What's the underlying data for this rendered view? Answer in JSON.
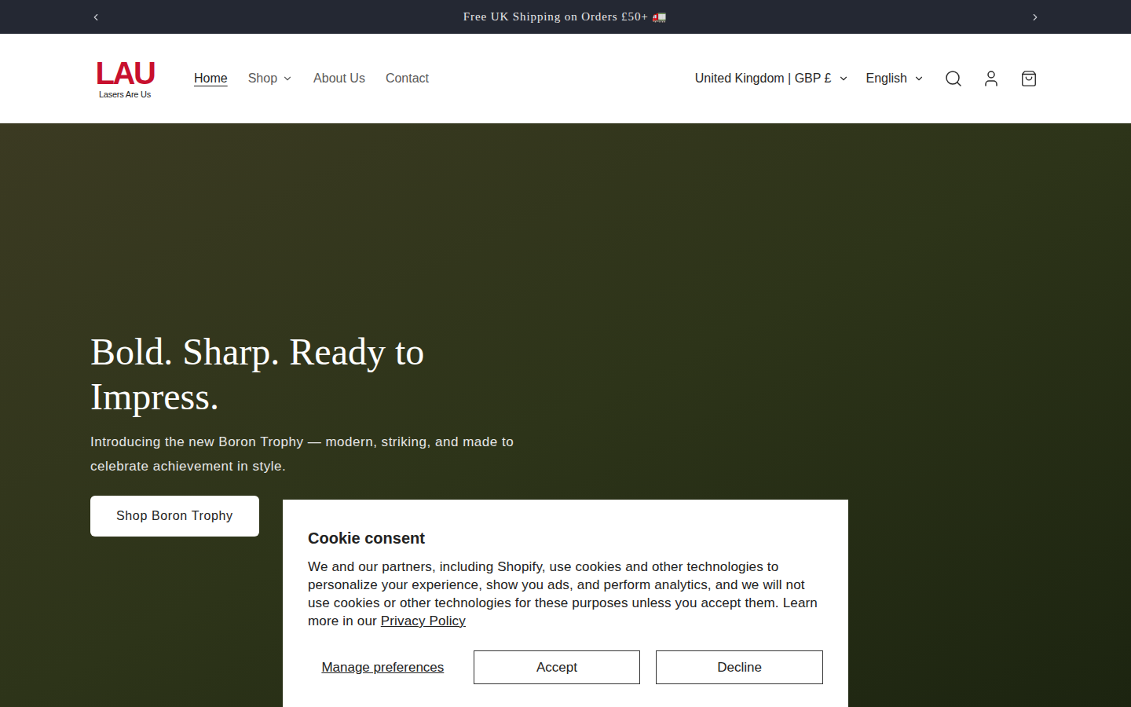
{
  "announcement": {
    "text": "Free UK Shipping on Orders £50+ 🚛"
  },
  "logo": {
    "mark": "LAU",
    "tagline": "Lasers Are Us"
  },
  "nav": [
    {
      "label": "Home",
      "selected": true,
      "dropdown": false
    },
    {
      "label": "Shop",
      "selected": false,
      "dropdown": true
    },
    {
      "label": "About Us",
      "selected": false,
      "dropdown": false
    },
    {
      "label": "Contact",
      "selected": false,
      "dropdown": false
    }
  ],
  "selectors": [
    {
      "label": "United Kingdom | GBP £"
    },
    {
      "label": "English"
    }
  ],
  "hero": {
    "heading": "Bold. Sharp. Ready to Impress.",
    "text": "Introducing the new Boron Trophy — modern, striking, and made to celebrate achievement in style.",
    "button": "Shop Boron Trophy"
  },
  "cookie": {
    "title": "Cookie consent",
    "body": "We and our partners, including Shopify, use cookies and other technologies to personalize your experience, show you ads, and perform analytics, and we will not use cookies or other technologies for these purposes unless you accept them. Learn more in our ",
    "link": "Privacy Policy",
    "manage": "Manage preferences",
    "buttons": [
      "Accept",
      "Decline"
    ]
  }
}
